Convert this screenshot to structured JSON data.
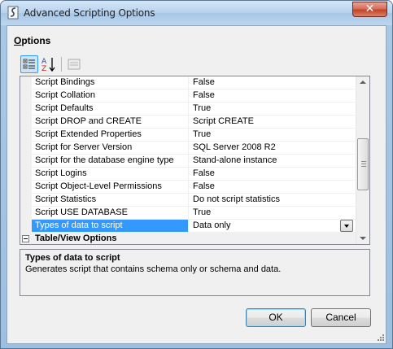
{
  "window": {
    "title": "Advanced Scripting Options",
    "close_label": "✕"
  },
  "options_label_mnemonic": "O",
  "options_label_rest": "ptions",
  "toolbar": {
    "categorized_icon": "categorized-icon",
    "alpha_icon": "alphabetical-sort-icon",
    "pages_icon": "property-pages-icon"
  },
  "properties": [
    {
      "name": "Script Bindings",
      "value": "False"
    },
    {
      "name": "Script Collation",
      "value": "False"
    },
    {
      "name": "Script Defaults",
      "value": "True"
    },
    {
      "name": "Script DROP and CREATE",
      "value": "Script CREATE"
    },
    {
      "name": "Script Extended Properties",
      "value": "True"
    },
    {
      "name": "Script for Server Version",
      "value": "SQL Server 2008 R2"
    },
    {
      "name": "Script for the database engine type",
      "value": "Stand-alone instance"
    },
    {
      "name": "Script Logins",
      "value": "False"
    },
    {
      "name": "Script Object-Level Permissions",
      "value": "False"
    },
    {
      "name": "Script Statistics",
      "value": "Do not script statistics"
    },
    {
      "name": "Script USE DATABASE",
      "value": "True"
    },
    {
      "name": "Types of data to script",
      "value": "Data only",
      "selected": true
    }
  ],
  "category": {
    "label": "Table/View Options"
  },
  "description": {
    "title": "Types of data to script",
    "text": "Generates script that contains schema only or schema and data."
  },
  "buttons": {
    "ok": "OK",
    "cancel": "Cancel"
  },
  "colors": {
    "selection": "#3399ff",
    "close_button": "#c2432a"
  }
}
